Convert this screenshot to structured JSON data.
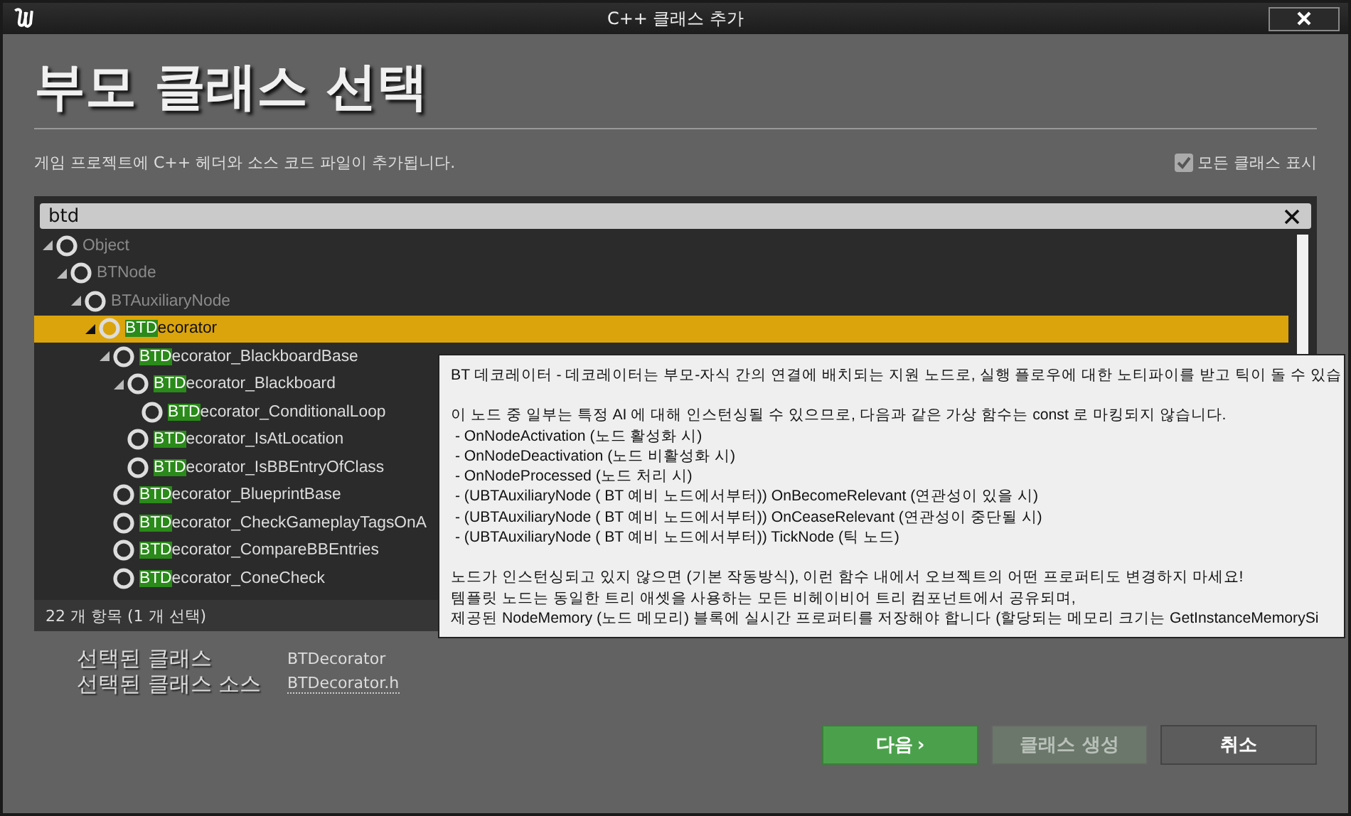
{
  "window": {
    "title": "C++ 클래스 추가"
  },
  "heading": "부모 클래스 선택",
  "description": "게임 프로젝트에 C++ 헤더와 소스 코드 파일이 추가됩니다.",
  "show_all_classes": {
    "label": "모든 클래스 표시",
    "checked": true
  },
  "search": {
    "value": "btd"
  },
  "tree": [
    {
      "name": "Object",
      "matched": false,
      "selected": false,
      "expanded": true,
      "children": [
        {
          "name": "BTNode",
          "matched": false,
          "selected": false,
          "expanded": true,
          "children": [
            {
              "name": "BTAuxiliaryNode",
              "matched": false,
              "selected": false,
              "expanded": true,
              "children": [
                {
                  "name": "BTDecorator",
                  "matched": true,
                  "selected": true,
                  "expanded": true,
                  "children": [
                    {
                      "name": "BTDecorator_BlackboardBase",
                      "matched": true,
                      "selected": false,
                      "expanded": true,
                      "children": [
                        {
                          "name": "BTDecorator_Blackboard",
                          "matched": true,
                          "selected": false,
                          "expanded": true,
                          "children": [
                            {
                              "name": "BTDecorator_ConditionalLoop",
                              "matched": true,
                              "selected": false,
                              "expanded": false
                            }
                          ]
                        },
                        {
                          "name": "BTDecorator_IsAtLocation",
                          "matched": true,
                          "selected": false,
                          "expanded": false
                        },
                        {
                          "name": "BTDecorator_IsBBEntryOfClass",
                          "matched": true,
                          "selected": false,
                          "expanded": false
                        }
                      ]
                    },
                    {
                      "name": "BTDecorator_BlueprintBase",
                      "matched": true,
                      "selected": false,
                      "expanded": false
                    },
                    {
                      "name": "BTDecorator_CheckGameplayTagsOnA",
                      "matched": true,
                      "selected": false,
                      "expanded": false
                    },
                    {
                      "name": "BTDecorator_CompareBBEntries",
                      "matched": true,
                      "selected": false,
                      "expanded": false
                    },
                    {
                      "name": "BTDecorator_ConeCheck",
                      "matched": true,
                      "selected": false,
                      "expanded": false
                    }
                  ]
                }
              ]
            }
          ]
        }
      ]
    }
  ],
  "item_count": "22 개 항목 (1 개 선택)",
  "tooltip": {
    "paragraphs": [
      [
        "BT 데코레이터 - 데코레이터는 부모-자식 간의 연결에 배치되는 지원 노드로, 실행 플로우에 대한 노티파이를 받고 틱이 돌 수 있습"
      ],
      [
        "이 노드 중 일부는 특정 AI 에 대해 인스턴싱될 수 있으므로, 다음과 같은 가상 함수는 const 로 마킹되지 않습니다.",
        " - OnNodeActivation (노드 활성화 시)",
        " - OnNodeDeactivation (노드 비활성화 시)",
        " - OnNodeProcessed (노드 처리 시)",
        " - (UBTAuxiliaryNode ( BT 예비 노드에서부터)) OnBecomeRelevant (연관성이 있을 시)",
        " - (UBTAuxiliaryNode ( BT 예비 노드에서부터)) OnCeaseRelevant (연관성이 중단될 시)",
        " - (UBTAuxiliaryNode ( BT 예비 노드에서부터)) TickNode (틱 노드)"
      ],
      [
        "노드가 인스턴싱되고 있지 않으면 (기본 작동방식), 이런 함수 내에서 오브젝트의 어떤 프로퍼티도 변경하지 마세요!",
        "템플릿 노드는 동일한 트리 애셋을 사용하는 모든 비헤이비어 트리 컴포넌트에서 공유되며,",
        "제공된 NodeMemory (노드 메모리) 블록에 실시간 프로퍼티를 저장해야 합니다 (할당되는 메모리 크기는 GetInstanceMemorySi"
      ]
    ]
  },
  "selected_info": [
    {
      "label": "선택된 클래스",
      "value": "BTDecorator",
      "kind": "text"
    },
    {
      "label": "선택된 클래스 소스",
      "value": "BTDecorator.h",
      "kind": "link"
    }
  ],
  "buttons": [
    {
      "label": "다음",
      "kind": "primary",
      "disabled": false,
      "icon": "›"
    },
    {
      "label": "클래스 생성",
      "kind": "normal",
      "disabled": true
    },
    {
      "label": "취소",
      "kind": "normal",
      "disabled": false
    }
  ]
}
